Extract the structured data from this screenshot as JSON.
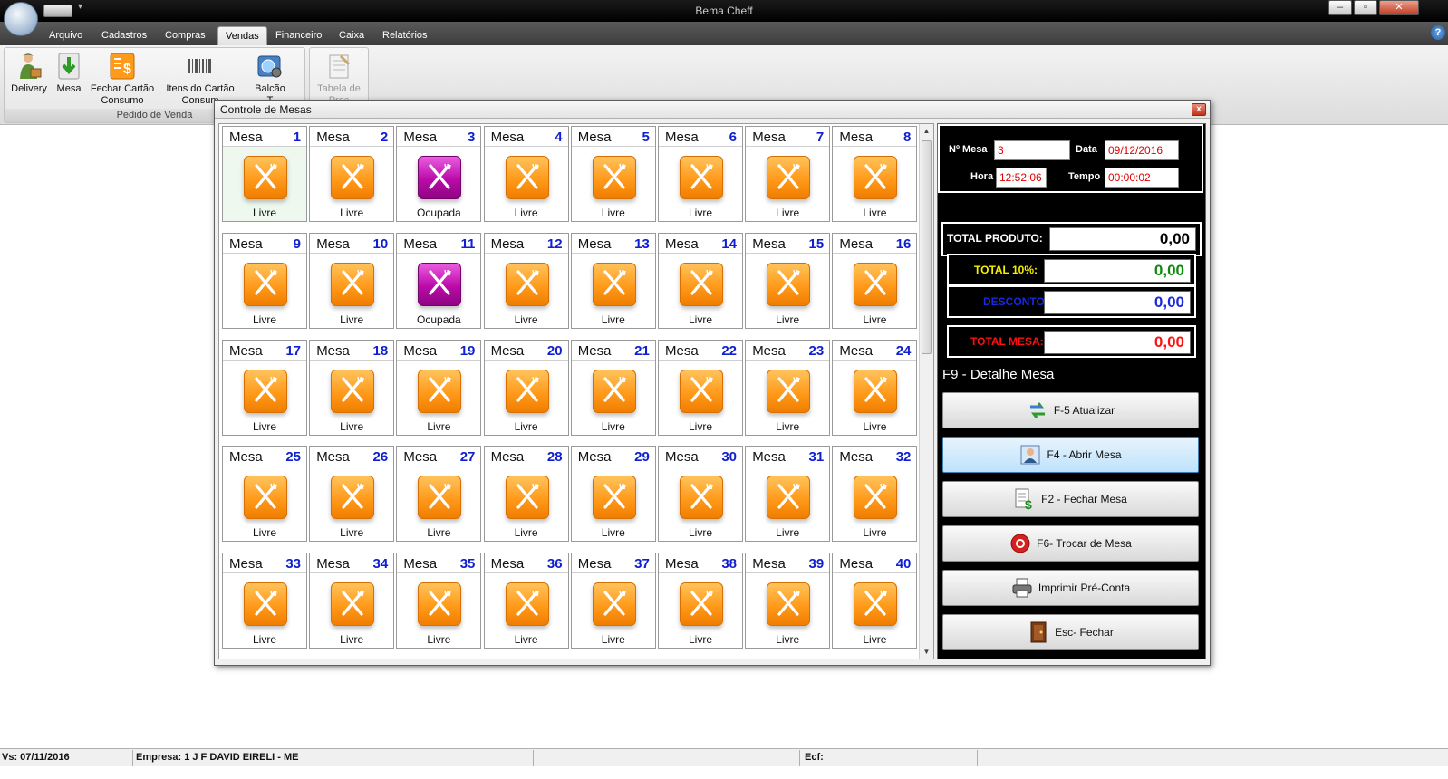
{
  "app": {
    "title": "Bema Cheff"
  },
  "menu": {
    "tabs": [
      "Arquivo",
      "Cadastros",
      "Compras",
      "Vendas",
      "Financeiro",
      "Caixa",
      "Relatórios"
    ],
    "active": "Vendas",
    "help": "?"
  },
  "ribbon": {
    "group_name": "Pedido de Venda",
    "buttons": [
      {
        "label": "Delivery",
        "icon": "delivery-person-icon"
      },
      {
        "label": "Mesa",
        "icon": "download-arrow-icon"
      },
      {
        "label": "Fechar Cartão\nConsumo",
        "icon": "dollar-document-icon"
      },
      {
        "label": "Itens do Cartão\nConsum",
        "icon": "barcode-icon"
      },
      {
        "label": "Balcão\nT",
        "icon": "globe-gear-icon"
      }
    ],
    "disabled_button": {
      "label": "Tabela de\nPreç",
      "icon": "price-table-icon"
    }
  },
  "window": {
    "title": "Controle de Mesas",
    "close": "x",
    "table_label": "Mesa",
    "tables": [
      {
        "number": 1,
        "status": "Livre"
      },
      {
        "number": 2,
        "status": "Livre"
      },
      {
        "number": 3,
        "status": "Ocupada"
      },
      {
        "number": 4,
        "status": "Livre"
      },
      {
        "number": 5,
        "status": "Livre"
      },
      {
        "number": 6,
        "status": "Livre"
      },
      {
        "number": 7,
        "status": "Livre"
      },
      {
        "number": 8,
        "status": "Livre"
      },
      {
        "number": 9,
        "status": "Livre"
      },
      {
        "number": 10,
        "status": "Livre"
      },
      {
        "number": 11,
        "status": "Ocupada"
      },
      {
        "number": 12,
        "status": "Livre"
      },
      {
        "number": 13,
        "status": "Livre"
      },
      {
        "number": 14,
        "status": "Livre"
      },
      {
        "number": 15,
        "status": "Livre"
      },
      {
        "number": 16,
        "status": "Livre"
      },
      {
        "number": 17,
        "status": "Livre"
      },
      {
        "number": 18,
        "status": "Livre"
      },
      {
        "number": 19,
        "status": "Livre"
      },
      {
        "number": 20,
        "status": "Livre"
      },
      {
        "number": 21,
        "status": "Livre"
      },
      {
        "number": 22,
        "status": "Livre"
      },
      {
        "number": 23,
        "status": "Livre"
      },
      {
        "number": 24,
        "status": "Livre"
      },
      {
        "number": 25,
        "status": "Livre"
      },
      {
        "number": 26,
        "status": "Livre"
      },
      {
        "number": 27,
        "status": "Livre"
      },
      {
        "number": 28,
        "status": "Livre"
      },
      {
        "number": 29,
        "status": "Livre"
      },
      {
        "number": 30,
        "status": "Livre"
      },
      {
        "number": 31,
        "status": "Livre"
      },
      {
        "number": 32,
        "status": "Livre"
      },
      {
        "number": 33,
        "status": "Livre"
      },
      {
        "number": 34,
        "status": "Livre"
      },
      {
        "number": 35,
        "status": "Livre"
      },
      {
        "number": 36,
        "status": "Livre"
      },
      {
        "number": 37,
        "status": "Livre"
      },
      {
        "number": 38,
        "status": "Livre"
      },
      {
        "number": 39,
        "status": "Livre"
      },
      {
        "number": 40,
        "status": "Livre"
      }
    ],
    "selected_table": 1,
    "colors": {
      "livre": "#ff9a1a",
      "ocupada": "#bb0aa9",
      "number": "#1020d0"
    }
  },
  "panel": {
    "mesa_label": "Nº Mesa",
    "mesa_value": "3",
    "data_label": "Data",
    "data_value": "09/12/2016",
    "hora_label": "Hora",
    "hora_value": "12:52:06",
    "tempo_label": "Tempo",
    "tempo_value": "00:00:02",
    "total_produto_label": "TOTAL PRODUTO:",
    "total_produto_value": "0,00",
    "total10_label": "TOTAL 10%:",
    "total10_value": "0,00",
    "desconto_label": "DESCONTO:",
    "desconto_value": "0,00",
    "total_mesa_label": "TOTAL MESA:",
    "total_mesa_value": "0,00",
    "detalhe": "F9 - Detalhe Mesa",
    "buttons": {
      "atualizar": "F-5  Atualizar",
      "abrir": "F4 - Abrir Mesa",
      "fechar": "F2 - Fechar  Mesa",
      "trocar": "F6- Trocar de Mesa",
      "imprimir": "Imprimir Pré-Conta",
      "sair": "Esc- Fechar"
    }
  },
  "status": {
    "version": "Vs: 07/11/2016",
    "empresa": "Empresa: 1 J F DAVID EIRELI - ME",
    "ecf": "Ecf:"
  }
}
